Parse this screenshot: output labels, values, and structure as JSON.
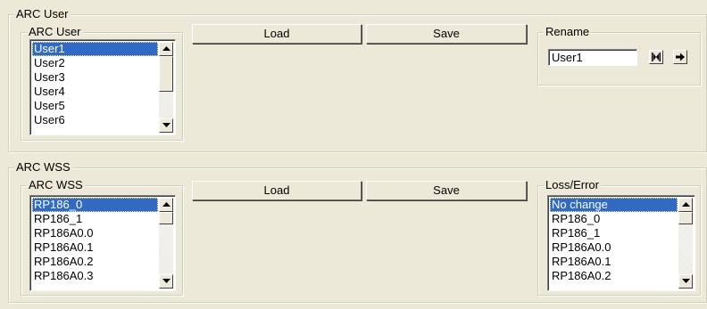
{
  "user_section": {
    "title": "ARC User",
    "list_title": "ARC User",
    "items": [
      "User1",
      "User2",
      "User3",
      "User4",
      "User5",
      "User6"
    ],
    "selected_index": 0,
    "load_label": "Load",
    "save_label": "Save",
    "rename": {
      "title": "Rename",
      "value": "User1"
    }
  },
  "wss_section": {
    "title": "ARC WSS",
    "list_title": "ARC WSS",
    "items": [
      "RP186_0",
      "RP186_1",
      "RP186A0.0",
      "RP186A0.1",
      "RP186A0.2",
      "RP186A0.3"
    ],
    "selected_index": 0,
    "load_label": "Load",
    "save_label": "Save",
    "loss_error": {
      "title": "Loss/Error",
      "items": [
        "No change",
        "RP186_0",
        "RP186_1",
        "RP186A0.0",
        "RP186A0.1",
        "RP186A0.2"
      ],
      "selected_index": 0
    }
  },
  "icons": {
    "rename_confirm": "expand-arrows-icon",
    "rename_apply": "arrow-right-icon"
  },
  "colors": {
    "selection": "#316ac5",
    "window_bg": "#ece9d8"
  }
}
